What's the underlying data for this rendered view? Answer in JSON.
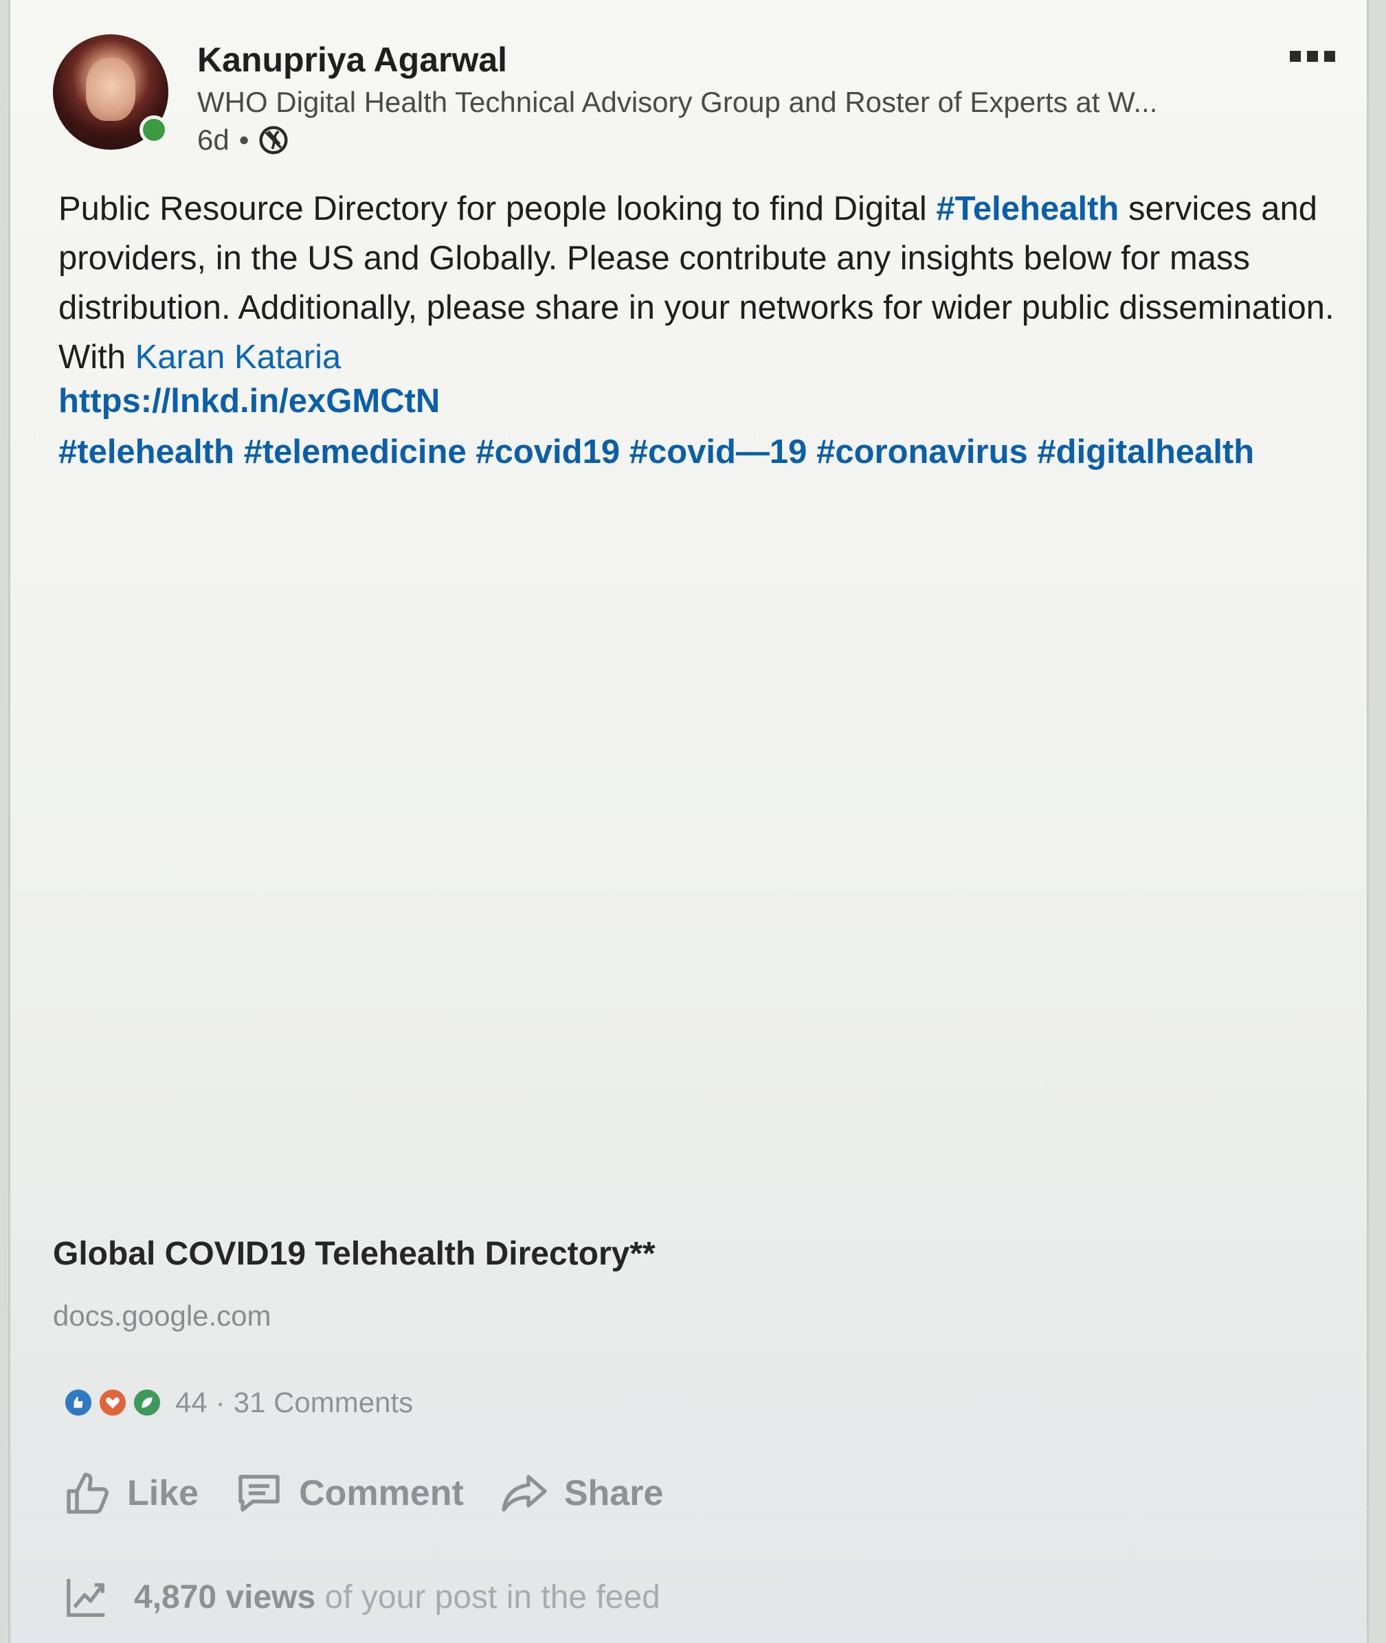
{
  "author": {
    "name": "Kanupriya Agarwal",
    "headline": "WHO Digital Health Technical Advisory Group and Roster of Experts at W...",
    "time": "6d",
    "separator": "•",
    "visibility_icon": "globe-icon",
    "online": true
  },
  "post": {
    "text_part1": "Public Resource Directory for people looking to find Digital ",
    "hashtag_inline": "#Telehealth",
    "text_part2": " services and providers, in the US and Globally. Please contribute any insights below for mass distribution. Additionally, please share in your networks for wider public dissemination. With ",
    "mention": "Karan Kataria",
    "link": "https://lnkd.in/exGMCtN",
    "tags": [
      "#telehealth",
      "#telemedicine",
      "#covid19",
      "#covid—19",
      "#coronavirus",
      "#digitalhealth"
    ]
  },
  "preview": {
    "title": "Global COVID19 Telehealth Directory**",
    "domain": "docs.google.com"
  },
  "social": {
    "reactions_count": "44",
    "dot": "·",
    "comments": "31 Comments",
    "reaction_icons": [
      "like-reaction-icon",
      "love-reaction-icon",
      "insightful-reaction-icon"
    ]
  },
  "actions": {
    "like": "Like",
    "comment": "Comment",
    "share": "Share"
  },
  "analytics": {
    "views_count": "4,870 views",
    "views_rest": " of your post in the feed"
  },
  "colors": {
    "link_blue": "#0a5fa8",
    "online_green": "#3c9a42",
    "muted_gray": "#8e9194"
  }
}
